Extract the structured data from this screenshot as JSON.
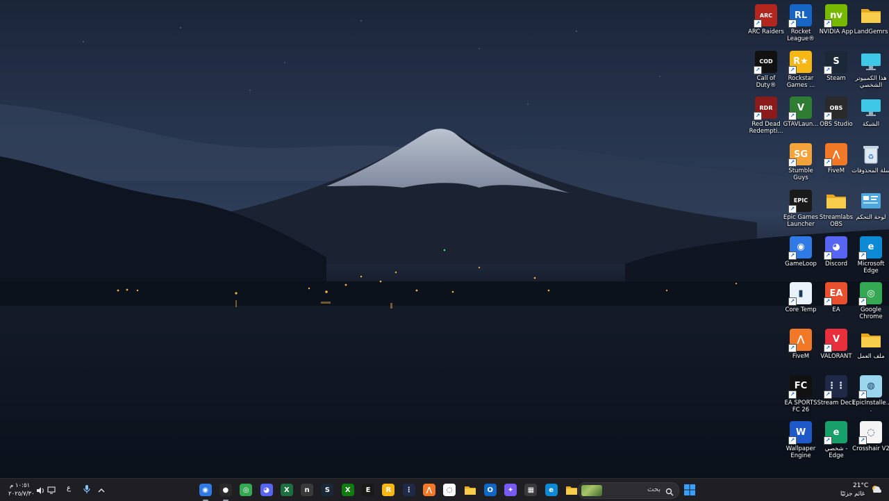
{
  "desktop": {
    "icons": [
      {
        "label": "ARC Raiders",
        "glyph": "ARC",
        "color": "#b3261e",
        "col": 4,
        "row": 0
      },
      {
        "label": "Rocket League®",
        "glyph": "RL",
        "color": "#1766c6",
        "col": 3,
        "row": 0
      },
      {
        "label": "NVIDIA App",
        "glyph": "nv",
        "color": "#76b900",
        "col": 2,
        "row": 0
      },
      {
        "label": "LandGemrs",
        "glyph": "",
        "color": "#f4c542",
        "col": 1,
        "row": 0,
        "icon": "folder-icon"
      },
      {
        "label": "Call of Duty®",
        "glyph": "COD",
        "color": "#111111",
        "col": 4,
        "row": 1
      },
      {
        "label": "Rockstar Games ...",
        "glyph": "R★",
        "color": "#f6b613",
        "col": 3,
        "row": 1
      },
      {
        "label": "Steam",
        "glyph": "S",
        "color": "#1b2838",
        "col": 2,
        "row": 1
      },
      {
        "label": "هذا الكمبيوتر الشخصي",
        "glyph": "",
        "color": "#3ec7e6",
        "col": 1,
        "row": 1,
        "icon": "monitor-icon"
      },
      {
        "label": "Red Dead Redempti...",
        "glyph": "RDR",
        "color": "#8b1a1a",
        "col": 4,
        "row": 2
      },
      {
        "label": "GTAVLaun...",
        "glyph": "V",
        "color": "#2e7d32",
        "col": 3,
        "row": 2
      },
      {
        "label": "OBS Studio",
        "glyph": "OBS",
        "color": "#2a2a2a",
        "col": 2,
        "row": 2
      },
      {
        "label": "الشبكة",
        "glyph": "",
        "color": "#3ec7e6",
        "col": 1,
        "row": 2,
        "icon": "network-icon"
      },
      {
        "label": "Stumble Guys",
        "glyph": "SG",
        "color": "#f2a43a",
        "col": 3,
        "row": 3
      },
      {
        "label": "FiveM",
        "glyph": "⋀",
        "color": "#f07826",
        "col": 2,
        "row": 3
      },
      {
        "label": "سلة المحذوفات",
        "glyph": "♻",
        "color": "#d7e3ee",
        "col": 1,
        "row": 3,
        "icon": "recycle-bin-icon"
      },
      {
        "label": "Epic Games Launcher",
        "glyph": "EPIC",
        "color": "#1a1a1a",
        "col": 3,
        "row": 4
      },
      {
        "label": "Streamlabs OBS",
        "glyph": "",
        "color": "#f4c542",
        "col": 2,
        "row": 4,
        "icon": "folder-icon"
      },
      {
        "label": "لوحة التحكم",
        "glyph": "",
        "color": "#4ea8de",
        "col": 1,
        "row": 4,
        "icon": "control-panel-icon"
      },
      {
        "label": "GameLoop",
        "glyph": "◉",
        "color": "#2f7ae5",
        "col": 3,
        "row": 5
      },
      {
        "label": "Discord",
        "glyph": "◕",
        "color": "#5865f2",
        "col": 2,
        "row": 5
      },
      {
        "label": "Microsoft Edge",
        "glyph": "e",
        "color": "#0c8ad6",
        "col": 1,
        "row": 5
      },
      {
        "label": "Core Temp",
        "glyph": "▮",
        "color": "#e9f2fb",
        "col": 3,
        "row": 6
      },
      {
        "label": "EA",
        "glyph": "EA",
        "color": "#e8502f",
        "col": 2,
        "row": 6
      },
      {
        "label": "Google Chrome",
        "glyph": "◎",
        "color": "#34a853",
        "col": 1,
        "row": 6
      },
      {
        "label": "FiveM",
        "glyph": "⋀",
        "color": "#f07826",
        "col": 3,
        "row": 7
      },
      {
        "label": "VALORANT",
        "glyph": "V",
        "color": "#e8303d",
        "col": 2,
        "row": 7
      },
      {
        "label": "ملف العمل",
        "glyph": "",
        "color": "#f4c542",
        "col": 1,
        "row": 7,
        "icon": "folder-icon"
      },
      {
        "label": "EA SPORTS FC 26",
        "glyph": "FC",
        "color": "#111111",
        "col": 3,
        "row": 8
      },
      {
        "label": "Stream Deck",
        "glyph": "⋮⋮",
        "color": "#1f2a48",
        "col": 2,
        "row": 8
      },
      {
        "label": "EpicInstalle...",
        "glyph": "◍",
        "color": "#9ad7ee",
        "col": 1,
        "row": 8
      },
      {
        "label": "Wallpaper Engine",
        "glyph": "W",
        "color": "#1e59c7",
        "col": 3,
        "row": 9
      },
      {
        "label": "شخصي - Edge",
        "glyph": "e",
        "color": "#18a06a",
        "col": 2,
        "row": 9
      },
      {
        "label": "Crosshair V2",
        "glyph": "◌",
        "color": "#f4f4f4",
        "col": 1,
        "row": 9
      }
    ]
  },
  "taskbar": {
    "weather": {
      "temp": "21°C",
      "condition": "غائم جزئيًا"
    },
    "search": {
      "placeholder": "بحث"
    },
    "apps": [
      {
        "name": "start-button",
        "glyph": "⊞",
        "color": "#3aa0ff"
      },
      {
        "name": "taskbar-file-explorer",
        "glyph": "",
        "color": "#f4c542"
      },
      {
        "name": "taskbar-edge",
        "glyph": "e",
        "color": "#0c8ad6"
      },
      {
        "name": "taskbar-store",
        "glyph": "▦",
        "color": "#3a3a3a"
      },
      {
        "name": "taskbar-copilot",
        "glyph": "✦",
        "color": "#7a5bf2"
      },
      {
        "name": "taskbar-outlook",
        "glyph": "O",
        "color": "#1066c4"
      },
      {
        "name": "taskbar-folder",
        "glyph": "",
        "color": "#f4c542"
      },
      {
        "name": "taskbar-crosshair",
        "glyph": "◌",
        "color": "#ffffff"
      },
      {
        "name": "taskbar-fivem",
        "glyph": "⋀",
        "color": "#f07826"
      },
      {
        "name": "taskbar-stream-deck",
        "glyph": "⋮",
        "color": "#1f2a48"
      },
      {
        "name": "taskbar-rockstar",
        "glyph": "R",
        "color": "#f6b613"
      },
      {
        "name": "taskbar-epic",
        "glyph": "E",
        "color": "#1a1a1a"
      },
      {
        "name": "taskbar-xbox",
        "glyph": "X",
        "color": "#107c10"
      },
      {
        "name": "taskbar-steam",
        "glyph": "S",
        "color": "#1b2838"
      },
      {
        "name": "taskbar-nvidia",
        "glyph": "n",
        "color": "#3a3a3a"
      },
      {
        "name": "taskbar-excel",
        "glyph": "X",
        "color": "#1d6f42"
      },
      {
        "name": "taskbar-discord",
        "glyph": "◕",
        "color": "#5865f2"
      },
      {
        "name": "taskbar-chrome",
        "glyph": "◎",
        "color": "#34a853"
      },
      {
        "name": "taskbar-obs",
        "glyph": "●",
        "color": "#2a2a2a"
      },
      {
        "name": "taskbar-gameloop",
        "glyph": "◉",
        "color": "#2f7ae5"
      }
    ],
    "tray": {
      "language": "ع",
      "time": "١٠:٥١ م",
      "date": "٢٠٢٥/٧/٣٠",
      "chevron": "^"
    }
  }
}
